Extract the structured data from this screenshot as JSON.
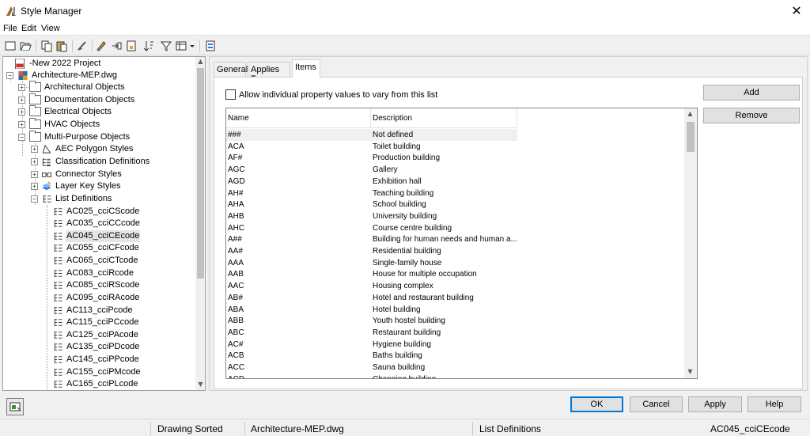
{
  "window": {
    "title": "Style Manager",
    "close_glyph": "✕"
  },
  "menu": [
    "File",
    "Edit",
    "View"
  ],
  "tree": {
    "project": "-New 2022 Project",
    "drawing": "Architecture-MEP.dwg",
    "categories": [
      "Architectural Objects",
      "Documentation Objects",
      "Electrical Objects",
      "HVAC Objects",
      "Multi-Purpose Objects"
    ],
    "multipurpose": [
      "AEC Polygon Styles",
      "Classification Definitions",
      "Connector Styles",
      "Layer Key Styles",
      "List Definitions"
    ],
    "lists": [
      "AC025_cciCScode",
      "AC035_cciCCcode",
      "AC045_cciCEcode",
      "AC055_cciCFcode",
      "AC065_cciCTcode",
      "AC083_cciRcode",
      "AC085_cciRScode",
      "AC095_cciRAcode",
      "AC113_cciPcode",
      "AC115_cciPCcode",
      "AC125_cciPAcode",
      "AC135_cciPDcode",
      "AC145_cciPPcode",
      "AC155_cciPMcode",
      "AC165_cciPLcode"
    ],
    "selected": "AC045_cciCEcode"
  },
  "tabs": [
    "General",
    "Applies To",
    "Items"
  ],
  "active_tab": "Items",
  "items": {
    "allow_checkbox_label": "Allow individual property values to vary from this list",
    "allow_checked": false,
    "columns": [
      "Name",
      "Description"
    ],
    "rows": [
      [
        "###",
        "Not defined"
      ],
      [
        "ACA",
        "Toilet building"
      ],
      [
        "AF#",
        "Production building"
      ],
      [
        "AGC",
        "Gallery"
      ],
      [
        "AGD",
        "Exhibition hall"
      ],
      [
        "AH#",
        "Teaching building"
      ],
      [
        "AHA",
        "School building"
      ],
      [
        "AHB",
        "University building"
      ],
      [
        "AHC",
        "Course centre building"
      ],
      [
        "A##",
        "Building for human needs and human a..."
      ],
      [
        "AA#",
        "Residential building"
      ],
      [
        "AAA",
        "Single-family house"
      ],
      [
        "AAB",
        "House for multiple occupation"
      ],
      [
        "AAC",
        "Housing complex"
      ],
      [
        "AB#",
        "Hotel and restaurant building"
      ],
      [
        "ABA",
        "Hotel building"
      ],
      [
        "ABB",
        "Youth hostel building"
      ],
      [
        "ABC",
        "Restaurant building"
      ],
      [
        "AC#",
        "Hygiene building"
      ],
      [
        "ACB",
        "Baths building"
      ],
      [
        "ACC",
        "Sauna building"
      ],
      [
        "ACD",
        "Changing building"
      ]
    ],
    "add_label": "Add",
    "remove_label": "Remove"
  },
  "buttons": {
    "ok": "OK",
    "cancel": "Cancel",
    "apply": "Apply",
    "help": "Help"
  },
  "status": {
    "state": "Drawing Sorted",
    "drawing": "Architecture-MEP.dwg",
    "category": "List Definitions",
    "style": "AC045_cciCEcode"
  },
  "colors": {
    "accent": "#0078d7",
    "selection": "#e5e5e5",
    "pdf_red": "#d32f2f"
  }
}
